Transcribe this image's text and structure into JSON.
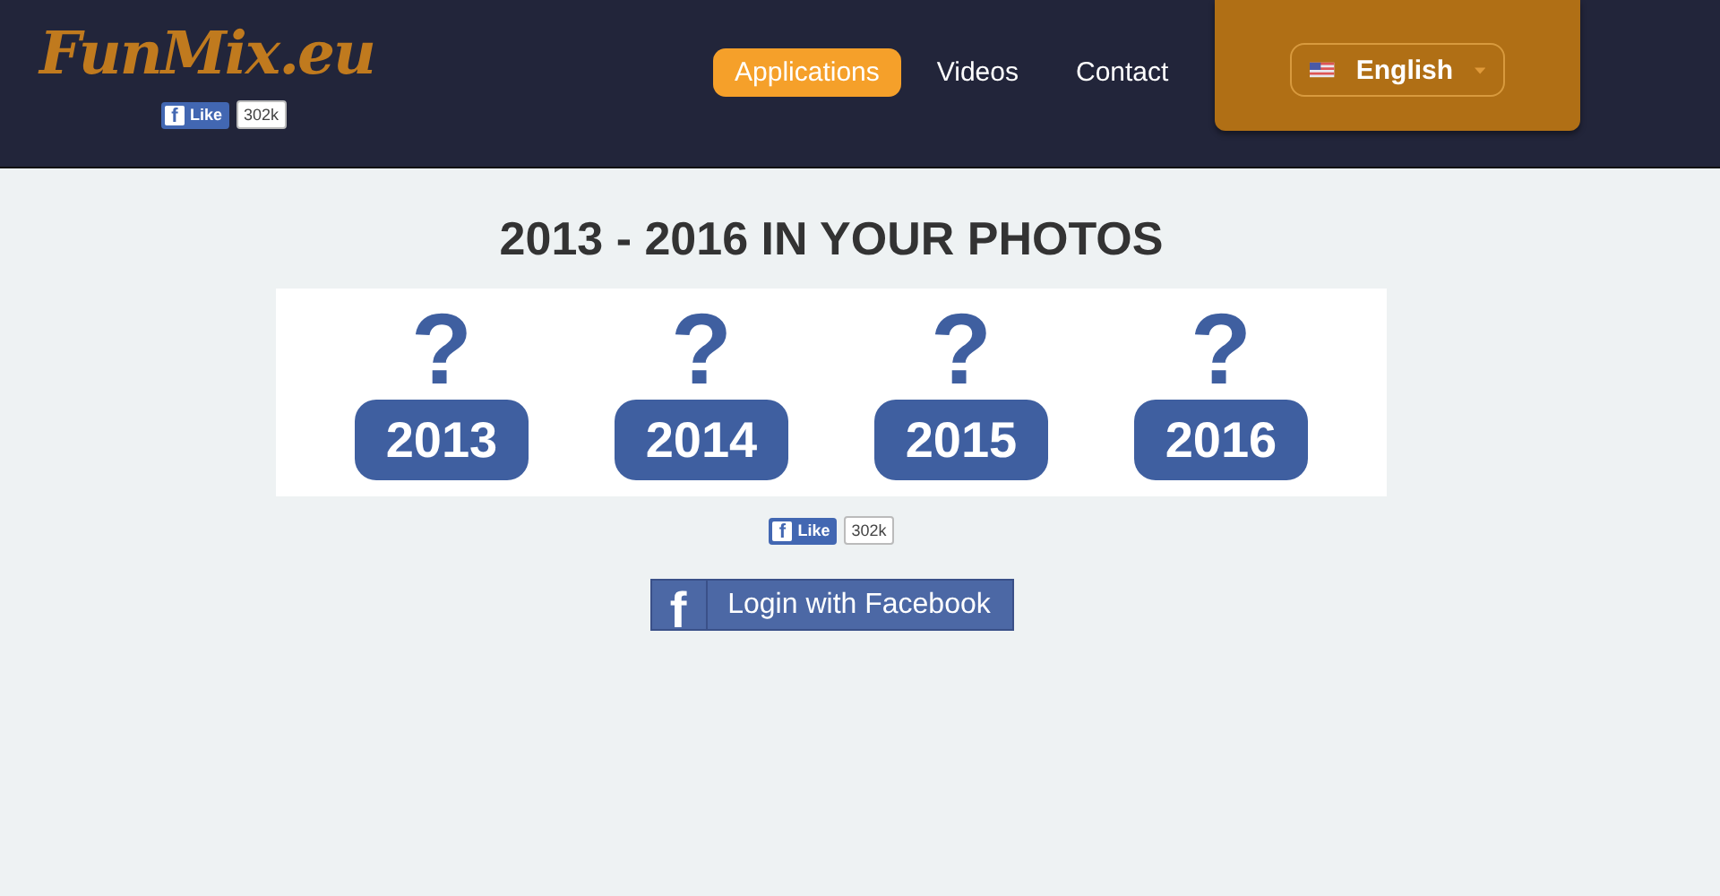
{
  "header": {
    "logo": "FunMix.eu",
    "like": {
      "glyph": "f",
      "label": "Like",
      "count": "302k"
    },
    "nav": [
      {
        "label": "Applications",
        "selected": true
      },
      {
        "label": "Videos",
        "selected": false
      },
      {
        "label": "Contact",
        "selected": false
      }
    ],
    "language": {
      "label": "English"
    }
  },
  "main": {
    "title": "2013 - 2016 IN YOUR PHOTOS",
    "years": [
      {
        "mark": "?",
        "year": "2013"
      },
      {
        "mark": "?",
        "year": "2014"
      },
      {
        "mark": "?",
        "year": "2015"
      },
      {
        "mark": "?",
        "year": "2016"
      }
    ],
    "like": {
      "glyph": "f",
      "label": "Like",
      "count": "302k"
    },
    "login": {
      "glyph": "f",
      "label": "Login with Facebook"
    }
  }
}
